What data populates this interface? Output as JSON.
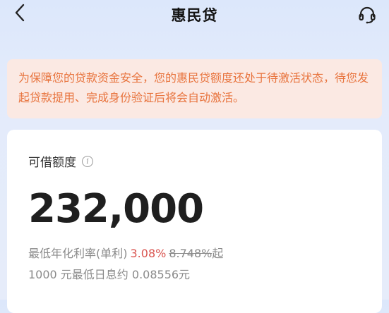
{
  "header": {
    "title": "惠民贷",
    "back_icon": "chevron-left-icon",
    "support_icon": "headset-icon"
  },
  "notice": {
    "text": "为保障您的贷款资金安全，您的惠民贷额度还处于待激活状态，待您发起贷款提用、完成身份验证后将会自动激活。"
  },
  "quota": {
    "label": "可借额度",
    "info_icon_glyph": "i",
    "amount": "232,000",
    "rate_prefix": "最低年化利率(单利)",
    "rate_value": "3.08%",
    "rate_original": "8.748%",
    "rate_suffix": "起",
    "interest_text": "1000 元最低日息约 0.08556元"
  },
  "colors": {
    "notice_text": "#e8743e",
    "notice_bg": "#fbe9e3",
    "rate_highlight": "#d9544f"
  }
}
